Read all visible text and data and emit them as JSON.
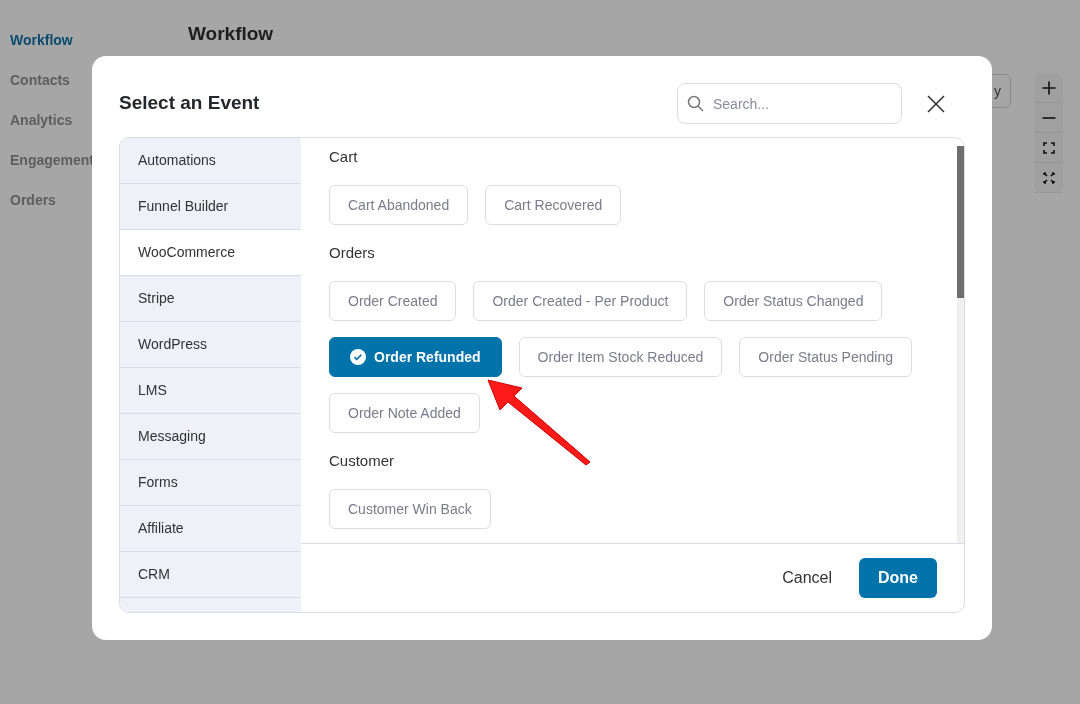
{
  "background": {
    "nav": [
      {
        "label": "Workflow",
        "selected": true
      },
      {
        "label": "Contacts",
        "selected": false
      },
      {
        "label": "Analytics",
        "selected": false
      },
      {
        "label": "Engagement",
        "selected": false
      },
      {
        "label": "Orders",
        "selected": false
      }
    ],
    "page_title": "Workflow",
    "toolbar_button": "y"
  },
  "dialog": {
    "title": "Select an Event",
    "search": {
      "placeholder": "Search..."
    },
    "categories": [
      {
        "label": "Automations",
        "selected": false
      },
      {
        "label": "Funnel Builder",
        "selected": false
      },
      {
        "label": "WooCommerce",
        "selected": true
      },
      {
        "label": "Stripe",
        "selected": false
      },
      {
        "label": "WordPress",
        "selected": false
      },
      {
        "label": "LMS",
        "selected": false
      },
      {
        "label": "Messaging",
        "selected": false
      },
      {
        "label": "Forms",
        "selected": false
      },
      {
        "label": "Affiliate",
        "selected": false
      },
      {
        "label": "CRM",
        "selected": false
      }
    ],
    "sections": [
      {
        "heading": "Cart",
        "events": [
          {
            "label": "Cart Abandoned",
            "selected": false
          },
          {
            "label": "Cart Recovered",
            "selected": false
          }
        ]
      },
      {
        "heading": "Orders",
        "events": [
          {
            "label": "Order Created",
            "selected": false
          },
          {
            "label": "Order Created - Per Product",
            "selected": false
          },
          {
            "label": "Order Status Changed",
            "selected": false
          },
          {
            "label": "Order Refunded",
            "selected": true
          },
          {
            "label": "Order Item Stock Reduced",
            "selected": false
          },
          {
            "label": "Order Status Pending",
            "selected": false
          },
          {
            "label": "Order Note Added",
            "selected": false
          }
        ]
      },
      {
        "heading": "Customer",
        "events": [
          {
            "label": "Customer Win Back",
            "selected": false
          }
        ]
      }
    ],
    "buttons": {
      "cancel": "Cancel",
      "done": "Done"
    }
  }
}
